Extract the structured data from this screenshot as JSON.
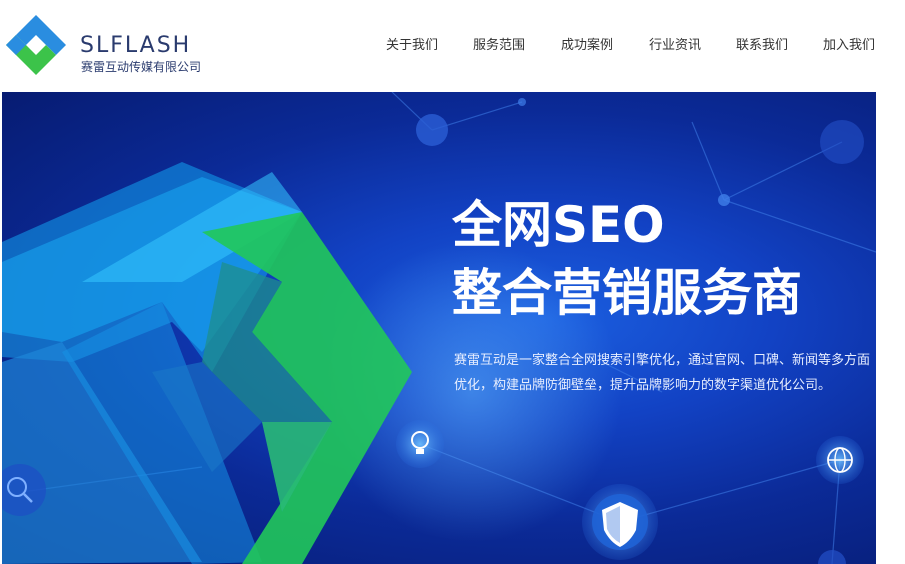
{
  "brand": {
    "name": "SLFLASH",
    "company": "赛雷互动传媒有限公司",
    "colors": {
      "blue": "#2a8de0",
      "green": "#3cc34a",
      "text": "#2a3b6e"
    }
  },
  "nav": {
    "items": [
      {
        "label": "关于我们"
      },
      {
        "label": "服务范围"
      },
      {
        "label": "成功案例"
      },
      {
        "label": "行业资讯"
      },
      {
        "label": "联系我们"
      },
      {
        "label": "加入我们"
      }
    ]
  },
  "hero": {
    "title": "全网SEO",
    "subtitle": "整合营销服务商",
    "description": "赛雷互动是一家整合全网搜索引擎优化，通过官网、口碑、新闻等多方面优化，构建品牌防御壁垒，提升品牌影响力的数字渠道优化公司。",
    "icons": [
      "shield-icon",
      "lightbulb-icon",
      "globe-icon",
      "search-icon",
      "network-node-icon"
    ],
    "colors": {
      "background": "#0b2a97",
      "accent_blue": "#1aa7f0",
      "accent_green": "#21c85a"
    }
  }
}
